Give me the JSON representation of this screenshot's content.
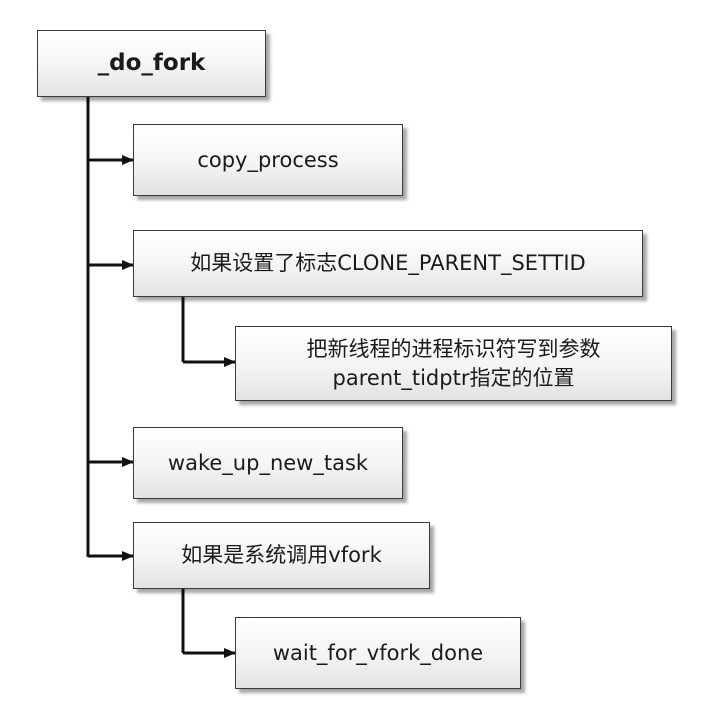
{
  "root": {
    "label": "_do_fork"
  },
  "steps": {
    "copy_process": {
      "label": "copy_process"
    },
    "settid_check": {
      "label": "如果设置了标志CLONE_PARENT_SETTID"
    },
    "write_tid": {
      "line1": "把新线程的进程标识符写到参数",
      "line2": "parent_tidptr指定的位置"
    },
    "wake_up": {
      "label": "wake_up_new_task"
    },
    "vfork_check": {
      "label": "如果是系统调用vfork"
    },
    "wait_vfork": {
      "label": "wait_for_vfork_done"
    }
  }
}
